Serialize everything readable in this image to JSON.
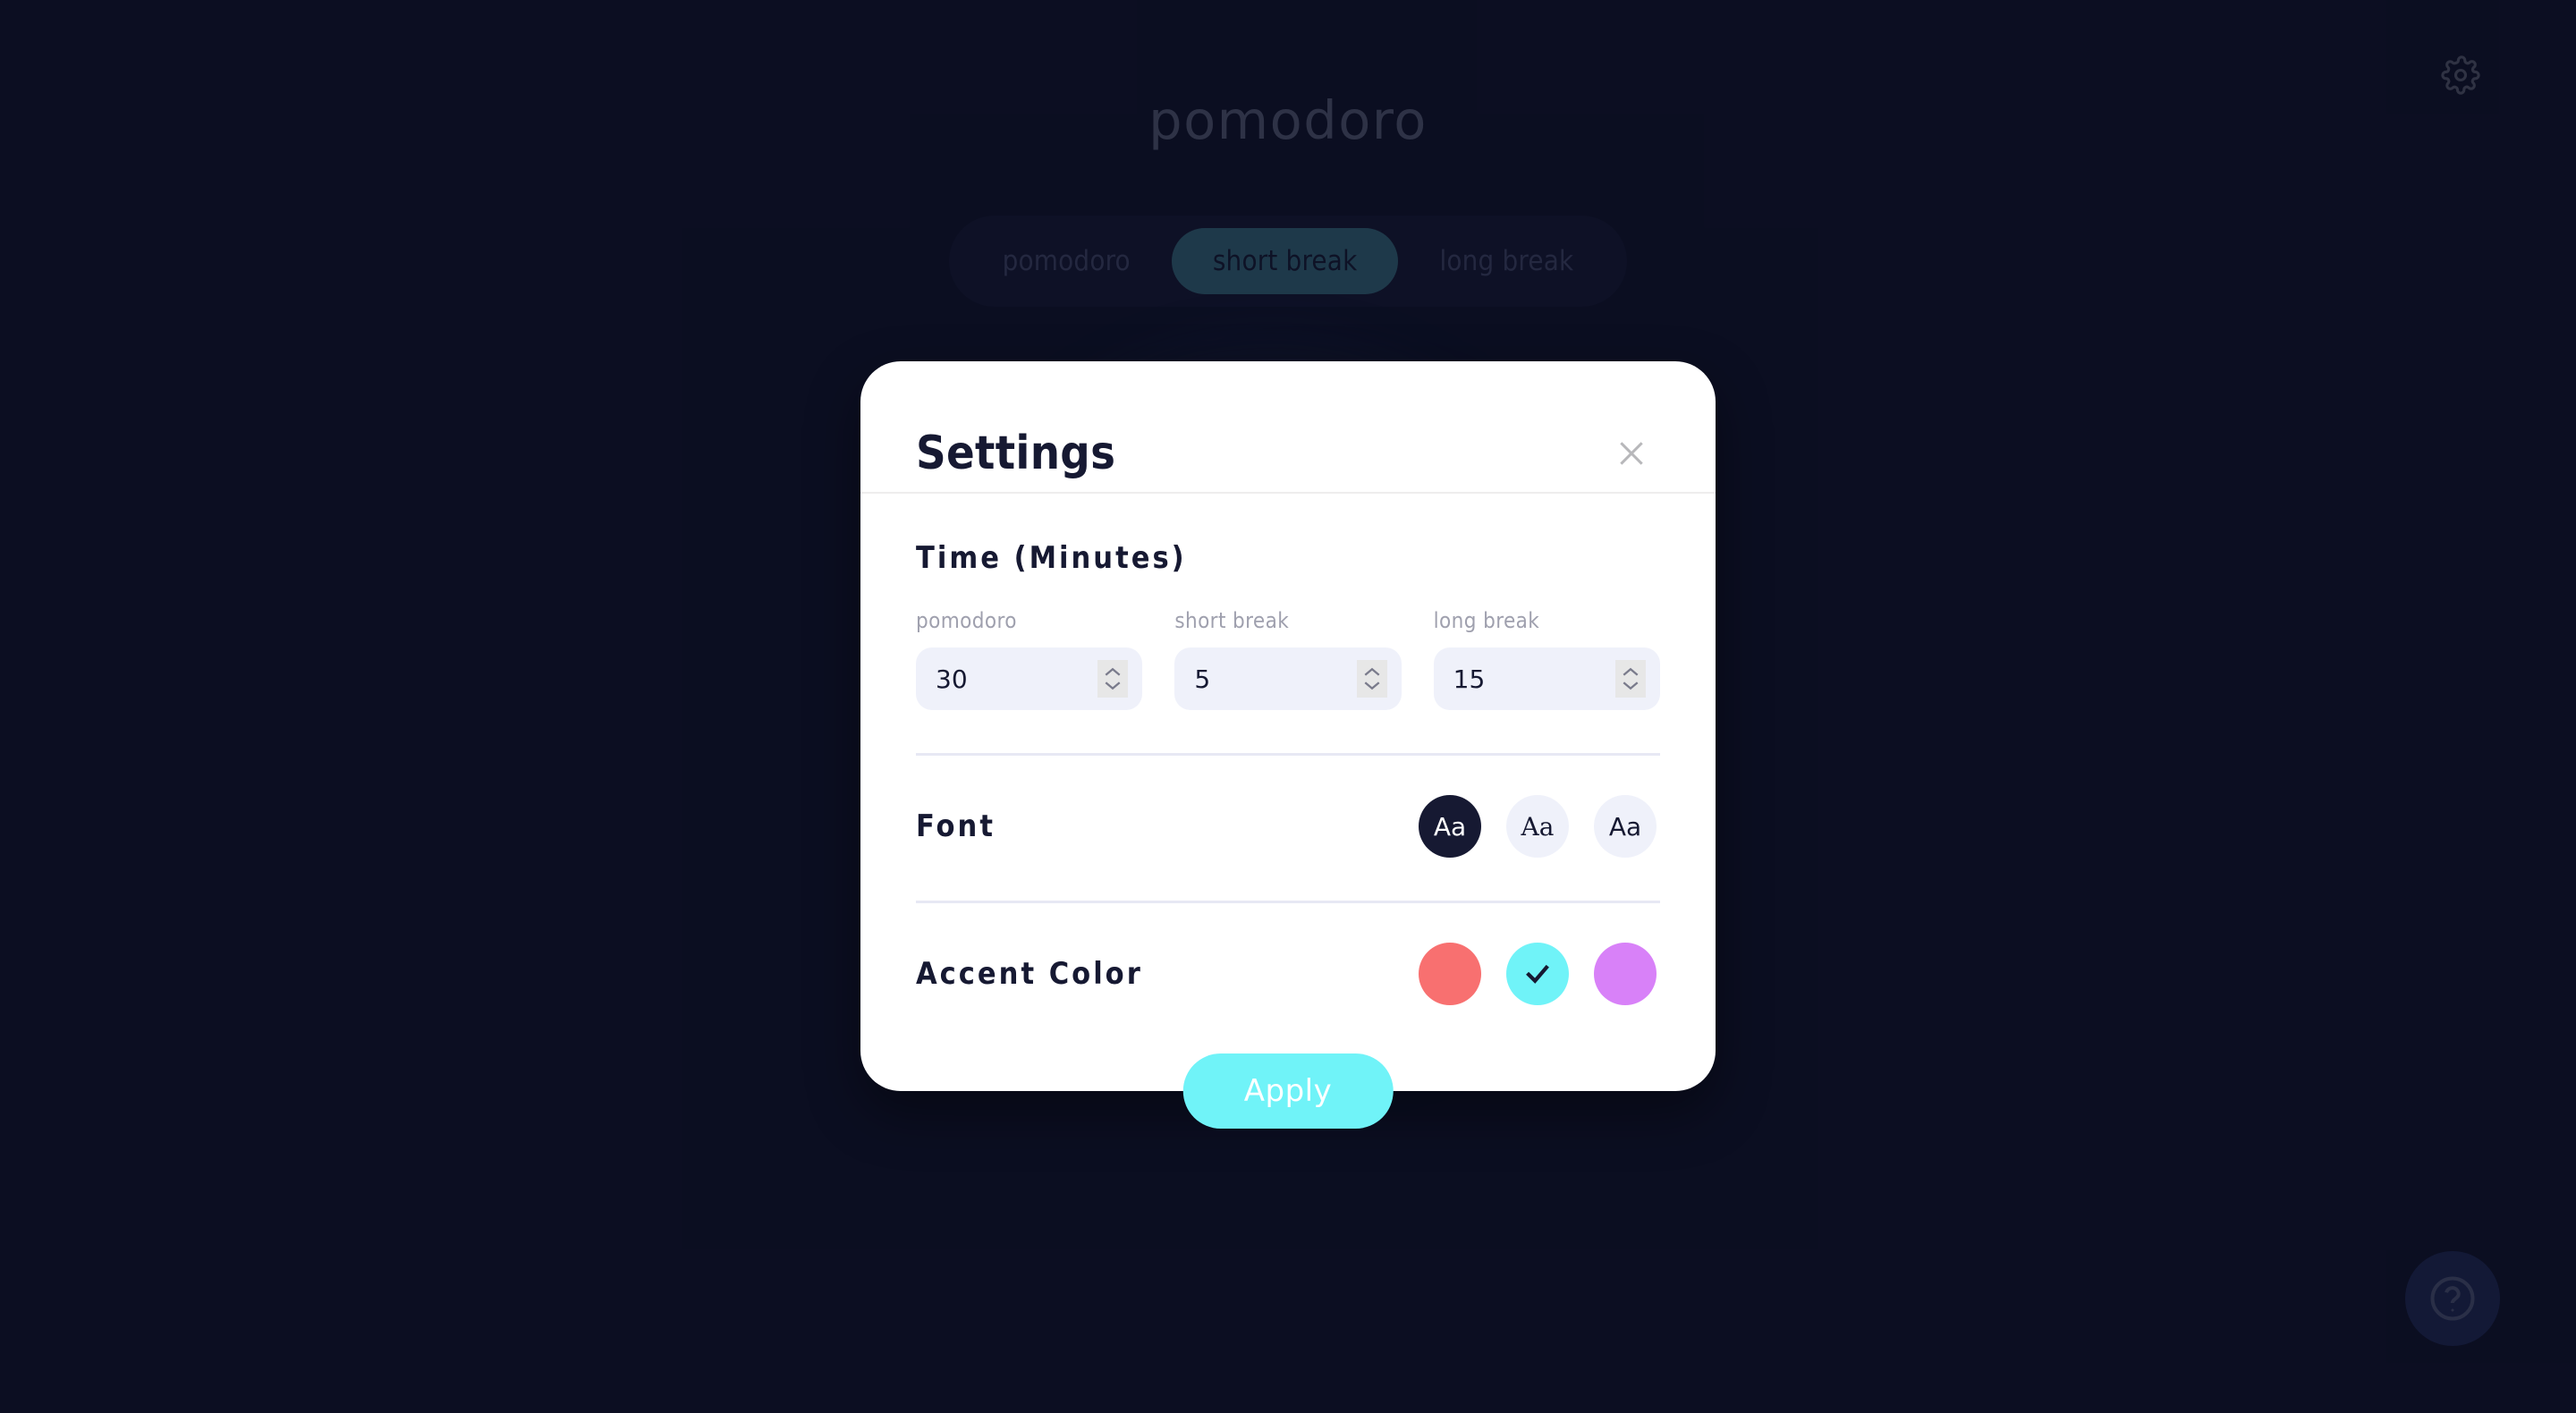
{
  "app": {
    "title": "pomodoro",
    "settings_icon": "gear-icon",
    "help_icon": "question-mark-circle-icon",
    "tabs": [
      {
        "label": "pomodoro",
        "active": false
      },
      {
        "label": "short break",
        "active": true
      },
      {
        "label": "long break",
        "active": false
      }
    ]
  },
  "modal": {
    "title": "Settings",
    "close_icon": "close-icon",
    "time_section": {
      "heading": "Time (Minutes)",
      "fields": [
        {
          "label": "pomodoro",
          "value": "30"
        },
        {
          "label": "short break",
          "value": "5"
        },
        {
          "label": "long break",
          "value": "15"
        }
      ],
      "spinner_up_icon": "chevron-up-icon",
      "spinner_down_icon": "chevron-down-icon"
    },
    "font_section": {
      "heading": "Font",
      "options": [
        {
          "label": "Aa",
          "style": "sans",
          "selected": true
        },
        {
          "label": "Aa",
          "style": "serif",
          "selected": false
        },
        {
          "label": "Aa",
          "style": "mono",
          "selected": false
        }
      ]
    },
    "accent_section": {
      "heading": "Accent Color",
      "check_icon": "check-icon",
      "options": [
        {
          "color": "#F87070",
          "selected": false
        },
        {
          "color": "#70F3F8",
          "selected": true
        },
        {
          "color": "#D881F8",
          "selected": false
        }
      ]
    },
    "apply_label": "Apply"
  },
  "colors": {
    "background": "#0E1127",
    "modal_background": "#FFFFFF",
    "text_dark": "#161932",
    "text_muted": "#9FA0AE",
    "input_background": "#EFF1FA",
    "accent_cyan": "#70F3F8",
    "accent_red": "#F87070",
    "accent_purple": "#D881F8",
    "tab_active": "#397080",
    "divider": "#E7E8F4"
  }
}
